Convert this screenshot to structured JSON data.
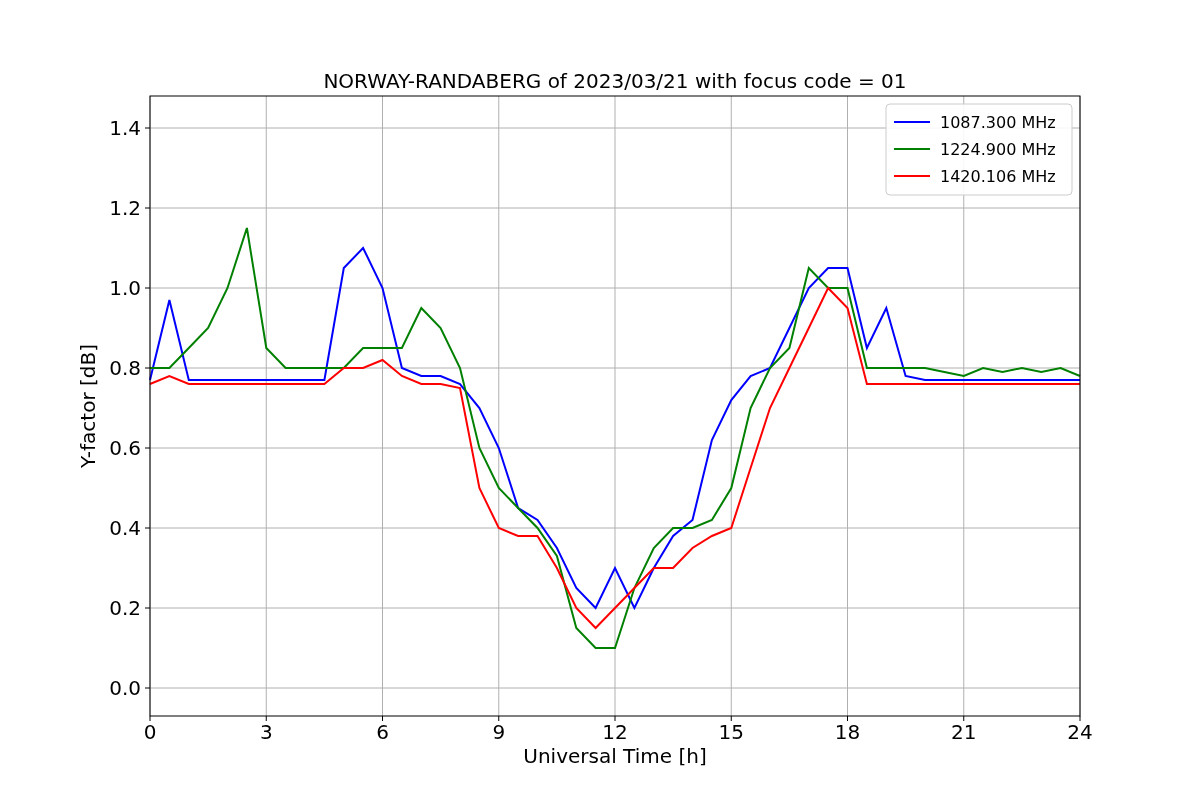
{
  "chart_data": {
    "type": "line",
    "title": "NORWAY-RANDABERG of 2023/03/21 with focus code = 01",
    "xlabel": "Universal Time [h]",
    "ylabel": "Y-factor [dB]",
    "x": [
      0,
      0.5,
      1,
      1.5,
      2,
      2.5,
      3,
      3.5,
      4,
      4.5,
      5,
      5.5,
      6,
      6.5,
      7,
      7.5,
      8,
      8.5,
      9,
      9.5,
      10,
      10.5,
      11,
      11.5,
      12,
      12.5,
      13,
      13.5,
      14,
      14.5,
      15,
      15.5,
      16,
      16.5,
      17,
      17.5,
      18,
      18.5,
      19,
      19.5,
      20,
      20.5,
      21,
      21.5,
      22,
      22.5,
      23,
      23.5,
      24
    ],
    "series": [
      {
        "name": "1087.300 MHz",
        "color": "#0000ff",
        "values": [
          0.77,
          0.97,
          0.77,
          0.77,
          0.77,
          0.77,
          0.77,
          0.77,
          0.77,
          0.77,
          1.05,
          1.1,
          1.0,
          0.8,
          0.78,
          0.78,
          0.76,
          0.7,
          0.6,
          0.45,
          0.42,
          0.35,
          0.25,
          0.2,
          0.3,
          0.2,
          0.3,
          0.38,
          0.42,
          0.62,
          0.72,
          0.78,
          0.8,
          0.9,
          1.0,
          1.05,
          1.05,
          0.85,
          0.95,
          0.78,
          0.77,
          0.77,
          0.77,
          0.77,
          0.77,
          0.77,
          0.77,
          0.77,
          0.77
        ]
      },
      {
        "name": "1224.900 MHz",
        "color": "#008000",
        "values": [
          0.8,
          0.8,
          0.85,
          0.9,
          1.0,
          1.15,
          0.85,
          0.8,
          0.8,
          0.8,
          0.8,
          0.85,
          0.85,
          0.85,
          0.95,
          0.9,
          0.8,
          0.6,
          0.5,
          0.45,
          0.4,
          0.33,
          0.15,
          0.1,
          0.1,
          0.25,
          0.35,
          0.4,
          0.4,
          0.42,
          0.5,
          0.7,
          0.8,
          0.85,
          1.05,
          1.0,
          1.0,
          0.8,
          0.8,
          0.8,
          0.8,
          0.79,
          0.78,
          0.8,
          0.79,
          0.8,
          0.79,
          0.8,
          0.78
        ]
      },
      {
        "name": "1420.106 MHz",
        "color": "#ff0000",
        "values": [
          0.76,
          0.78,
          0.76,
          0.76,
          0.76,
          0.76,
          0.76,
          0.76,
          0.76,
          0.76,
          0.8,
          0.8,
          0.82,
          0.78,
          0.76,
          0.76,
          0.75,
          0.5,
          0.4,
          0.38,
          0.38,
          0.3,
          0.2,
          0.15,
          0.2,
          0.25,
          0.3,
          0.3,
          0.35,
          0.38,
          0.4,
          0.55,
          0.7,
          0.8,
          0.9,
          1.0,
          0.95,
          0.76,
          0.76,
          0.76,
          0.76,
          0.76,
          0.76,
          0.76,
          0.76,
          0.76,
          0.76,
          0.76,
          0.76
        ]
      }
    ],
    "grid": true,
    "legend": true,
    "xlim": [
      0,
      24
    ],
    "ylim": [
      -0.07,
      1.48
    ],
    "xticks": [
      0,
      3,
      6,
      9,
      12,
      15,
      18,
      21,
      24
    ],
    "yticks": [
      {
        "value": 0,
        "label": "0.0"
      },
      {
        "value": 0.2,
        "label": "0.2"
      },
      {
        "value": 0.4,
        "label": "0.4"
      },
      {
        "value": 0.6,
        "label": "0.6"
      },
      {
        "value": 0.8,
        "label": "0.8"
      },
      {
        "value": 1,
        "label": "1.0"
      },
      {
        "value": 1.2,
        "label": "1.2"
      },
      {
        "value": 1.4,
        "label": "1.4"
      }
    ]
  }
}
